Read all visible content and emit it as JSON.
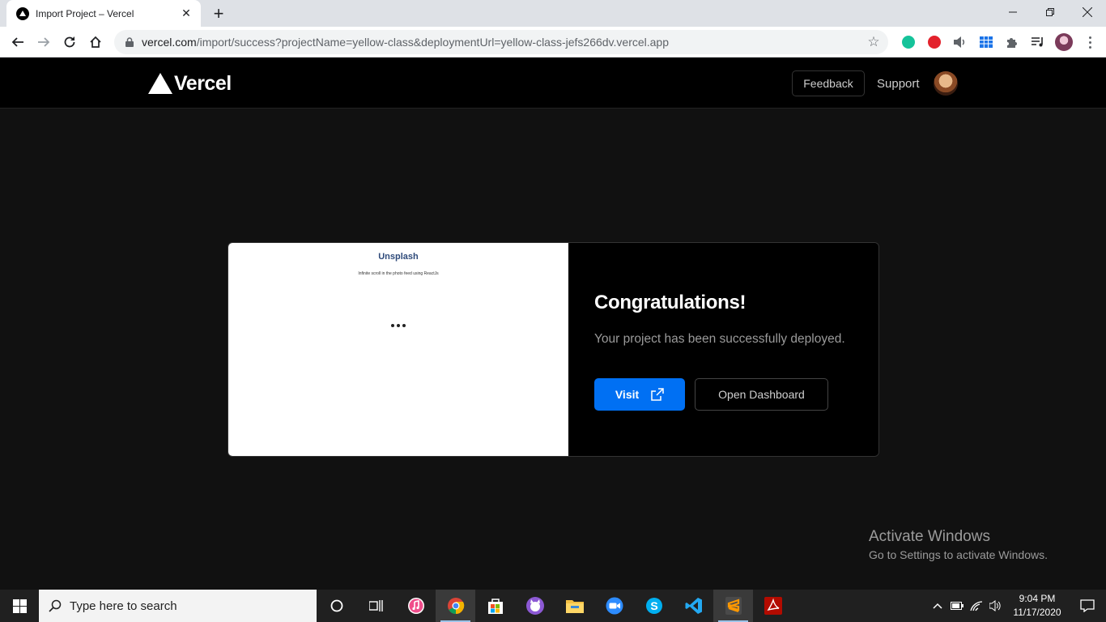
{
  "browser": {
    "tab_title": "Import Project – Vercel",
    "url_host": "vercel.com",
    "url_path": "/import/success?projectName=yellow-class&deploymentUrl=yellow-class-jefs266dv.vercel.app"
  },
  "header": {
    "logo_text": "Vercel",
    "feedback_label": "Feedback",
    "support_label": "Support"
  },
  "preview": {
    "title": "Unsplash",
    "subtitle": "Infinite scroll in the photo feed using ReactJs"
  },
  "success": {
    "heading": "Congratulations!",
    "message": "Your project has been successfully deployed.",
    "visit_label": "Visit",
    "dashboard_label": "Open Dashboard"
  },
  "watermark": {
    "title": "Activate Windows",
    "subtitle": "Go to Settings to activate Windows."
  },
  "taskbar": {
    "search_placeholder": "Type here to search",
    "time": "9:04 PM",
    "date": "11/17/2020"
  },
  "colors": {
    "accent": "#0070f3",
    "page_bg": "#111111",
    "header_bg": "#000000"
  }
}
